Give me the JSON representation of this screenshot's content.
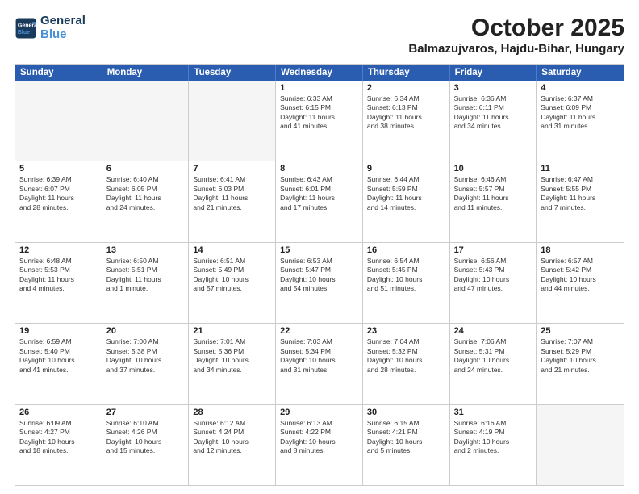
{
  "logo": {
    "line1": "General",
    "line2": "Blue"
  },
  "title": "October 2025",
  "subtitle": "Balmazujvaros, Hajdu-Bihar, Hungary",
  "weekdays": [
    "Sunday",
    "Monday",
    "Tuesday",
    "Wednesday",
    "Thursday",
    "Friday",
    "Saturday"
  ],
  "rows": [
    [
      {
        "day": "",
        "info": "",
        "empty": true
      },
      {
        "day": "",
        "info": "",
        "empty": true
      },
      {
        "day": "",
        "info": "",
        "empty": true
      },
      {
        "day": "1",
        "info": "Sunrise: 6:33 AM\nSunset: 6:15 PM\nDaylight: 11 hours\nand 41 minutes."
      },
      {
        "day": "2",
        "info": "Sunrise: 6:34 AM\nSunset: 6:13 PM\nDaylight: 11 hours\nand 38 minutes."
      },
      {
        "day": "3",
        "info": "Sunrise: 6:36 AM\nSunset: 6:11 PM\nDaylight: 11 hours\nand 34 minutes."
      },
      {
        "day": "4",
        "info": "Sunrise: 6:37 AM\nSunset: 6:09 PM\nDaylight: 11 hours\nand 31 minutes."
      }
    ],
    [
      {
        "day": "5",
        "info": "Sunrise: 6:39 AM\nSunset: 6:07 PM\nDaylight: 11 hours\nand 28 minutes."
      },
      {
        "day": "6",
        "info": "Sunrise: 6:40 AM\nSunset: 6:05 PM\nDaylight: 11 hours\nand 24 minutes."
      },
      {
        "day": "7",
        "info": "Sunrise: 6:41 AM\nSunset: 6:03 PM\nDaylight: 11 hours\nand 21 minutes."
      },
      {
        "day": "8",
        "info": "Sunrise: 6:43 AM\nSunset: 6:01 PM\nDaylight: 11 hours\nand 17 minutes."
      },
      {
        "day": "9",
        "info": "Sunrise: 6:44 AM\nSunset: 5:59 PM\nDaylight: 11 hours\nand 14 minutes."
      },
      {
        "day": "10",
        "info": "Sunrise: 6:46 AM\nSunset: 5:57 PM\nDaylight: 11 hours\nand 11 minutes."
      },
      {
        "day": "11",
        "info": "Sunrise: 6:47 AM\nSunset: 5:55 PM\nDaylight: 11 hours\nand 7 minutes."
      }
    ],
    [
      {
        "day": "12",
        "info": "Sunrise: 6:48 AM\nSunset: 5:53 PM\nDaylight: 11 hours\nand 4 minutes."
      },
      {
        "day": "13",
        "info": "Sunrise: 6:50 AM\nSunset: 5:51 PM\nDaylight: 11 hours\nand 1 minute."
      },
      {
        "day": "14",
        "info": "Sunrise: 6:51 AM\nSunset: 5:49 PM\nDaylight: 10 hours\nand 57 minutes."
      },
      {
        "day": "15",
        "info": "Sunrise: 6:53 AM\nSunset: 5:47 PM\nDaylight: 10 hours\nand 54 minutes."
      },
      {
        "day": "16",
        "info": "Sunrise: 6:54 AM\nSunset: 5:45 PM\nDaylight: 10 hours\nand 51 minutes."
      },
      {
        "day": "17",
        "info": "Sunrise: 6:56 AM\nSunset: 5:43 PM\nDaylight: 10 hours\nand 47 minutes."
      },
      {
        "day": "18",
        "info": "Sunrise: 6:57 AM\nSunset: 5:42 PM\nDaylight: 10 hours\nand 44 minutes."
      }
    ],
    [
      {
        "day": "19",
        "info": "Sunrise: 6:59 AM\nSunset: 5:40 PM\nDaylight: 10 hours\nand 41 minutes."
      },
      {
        "day": "20",
        "info": "Sunrise: 7:00 AM\nSunset: 5:38 PM\nDaylight: 10 hours\nand 37 minutes."
      },
      {
        "day": "21",
        "info": "Sunrise: 7:01 AM\nSunset: 5:36 PM\nDaylight: 10 hours\nand 34 minutes."
      },
      {
        "day": "22",
        "info": "Sunrise: 7:03 AM\nSunset: 5:34 PM\nDaylight: 10 hours\nand 31 minutes."
      },
      {
        "day": "23",
        "info": "Sunrise: 7:04 AM\nSunset: 5:32 PM\nDaylight: 10 hours\nand 28 minutes."
      },
      {
        "day": "24",
        "info": "Sunrise: 7:06 AM\nSunset: 5:31 PM\nDaylight: 10 hours\nand 24 minutes."
      },
      {
        "day": "25",
        "info": "Sunrise: 7:07 AM\nSunset: 5:29 PM\nDaylight: 10 hours\nand 21 minutes."
      }
    ],
    [
      {
        "day": "26",
        "info": "Sunrise: 6:09 AM\nSunset: 4:27 PM\nDaylight: 10 hours\nand 18 minutes."
      },
      {
        "day": "27",
        "info": "Sunrise: 6:10 AM\nSunset: 4:26 PM\nDaylight: 10 hours\nand 15 minutes."
      },
      {
        "day": "28",
        "info": "Sunrise: 6:12 AM\nSunset: 4:24 PM\nDaylight: 10 hours\nand 12 minutes."
      },
      {
        "day": "29",
        "info": "Sunrise: 6:13 AM\nSunset: 4:22 PM\nDaylight: 10 hours\nand 8 minutes."
      },
      {
        "day": "30",
        "info": "Sunrise: 6:15 AM\nSunset: 4:21 PM\nDaylight: 10 hours\nand 5 minutes."
      },
      {
        "day": "31",
        "info": "Sunrise: 6:16 AM\nSunset: 4:19 PM\nDaylight: 10 hours\nand 2 minutes."
      },
      {
        "day": "",
        "info": "",
        "empty": true
      }
    ]
  ]
}
